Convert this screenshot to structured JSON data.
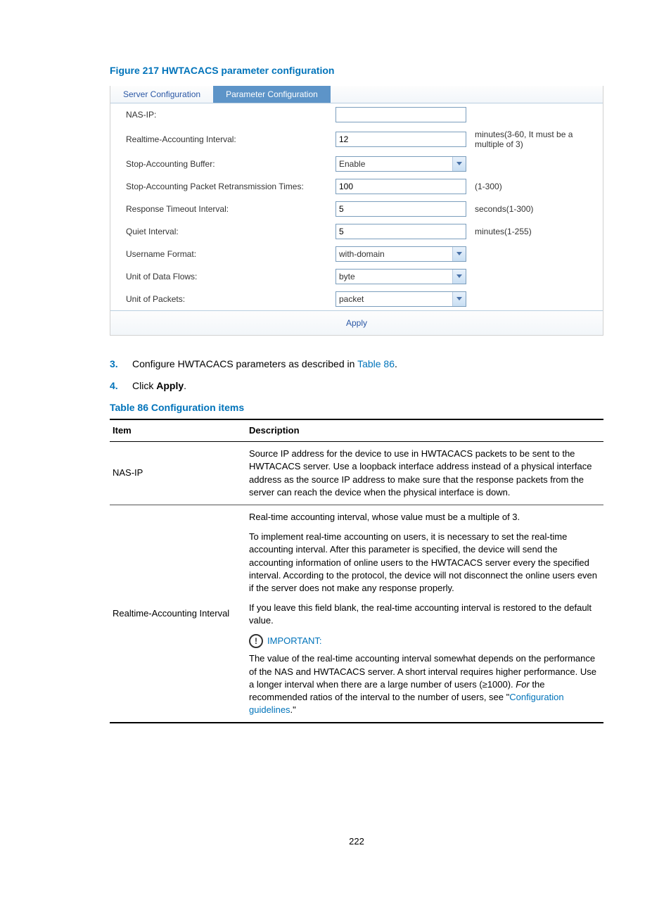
{
  "figure_title": "Figure 217 HWTACACS parameter configuration",
  "tabs": {
    "server": "Server Configuration",
    "parameter": "Parameter Configuration"
  },
  "form": {
    "nas_ip": {
      "label": "NAS-IP:",
      "value": "",
      "hint": ""
    },
    "realtime": {
      "label": "Realtime-Accounting Interval:",
      "value": "12",
      "hint": "minutes(3-60, It must be a multiple of 3)"
    },
    "stop_buffer": {
      "label": "Stop-Accounting Buffer:",
      "value": "Enable",
      "hint": ""
    },
    "stop_retrans": {
      "label": "Stop-Accounting Packet Retransmission Times:",
      "value": "100",
      "hint": "(1-300)"
    },
    "resp_timeout": {
      "label": "Response Timeout Interval:",
      "value": "5",
      "hint": "seconds(1-300)"
    },
    "quiet": {
      "label": "Quiet Interval:",
      "value": "5",
      "hint": "minutes(1-255)"
    },
    "user_fmt": {
      "label": "Username Format:",
      "value": "with-domain",
      "hint": ""
    },
    "data_flow": {
      "label": "Unit of Data Flows:",
      "value": "byte",
      "hint": ""
    },
    "packets": {
      "label": "Unit of Packets:",
      "value": "packet",
      "hint": ""
    }
  },
  "apply_label": "Apply",
  "steps": {
    "s3_num": "3.",
    "s3_pre": "Configure HWTACACS parameters as described in ",
    "s3_link": "Table 86",
    "s3_post": ".",
    "s4_num": "4.",
    "s4_pre": "Click ",
    "s4_bold": "Apply",
    "s4_post": "."
  },
  "table_title": "Table 86 Configuration items",
  "headers": {
    "item": "Item",
    "desc": "Description"
  },
  "rows": {
    "r1": {
      "item": "NAS-IP",
      "desc": "Source IP address for the device to use in HWTACACS packets to be sent to the HWTACACS server. Use a loopback interface address instead of a physical interface address as the source IP address to make sure that the response packets from the server can reach the device when the physical interface is down."
    },
    "r2": {
      "item": "Realtime-Accounting Interval",
      "p1": "Real-time accounting interval, whose value must be a multiple of 3.",
      "p2": "To implement real-time accounting on users, it is necessary to set the real-time accounting interval. After this parameter is specified, the device will send the accounting information of online users to the HWTACACS server every the specified interval. According to the protocol, the device will not disconnect the online users even if the server does not make any response properly.",
      "p3": "If you leave this field blank, the real-time accounting interval is restored to the default value.",
      "important_label": "IMPORTANT:",
      "p4_a": "The value of the real-time accounting interval somewhat depends on the performance of the NAS and HWTACACS server. A short interval requires higher performance. Use a longer interval when there are a large number of users (≥1000). ",
      "p4_italic": "For",
      "p4_b": " the recommended ratios of the interval to the number of users, see \"",
      "p4_link": "Configuration guidelines",
      "p4_c": ".\""
    }
  },
  "page_number": "222"
}
